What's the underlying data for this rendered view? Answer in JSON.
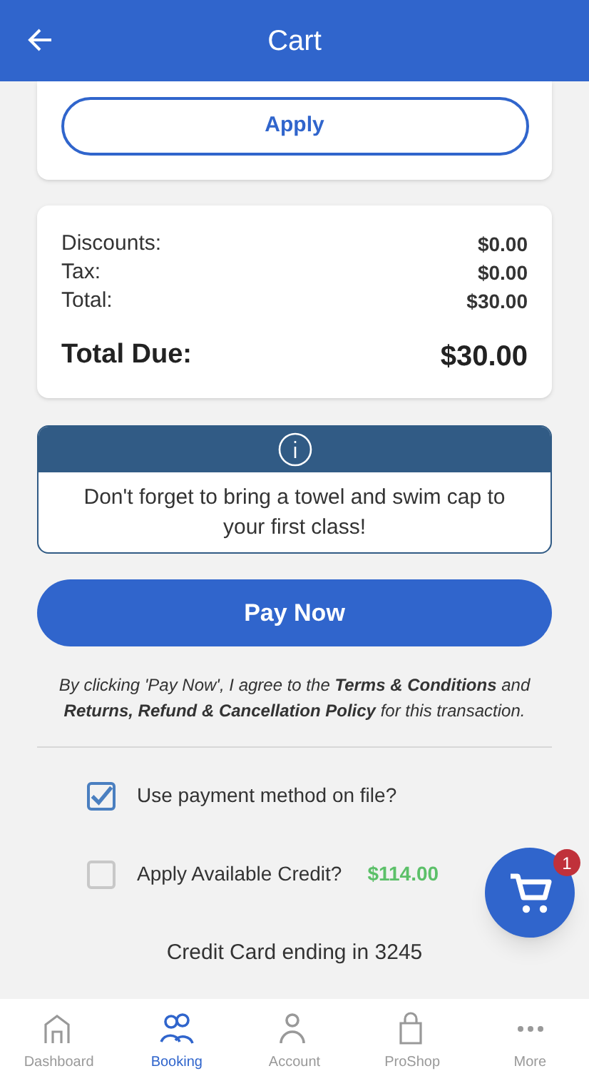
{
  "header": {
    "title": "Cart"
  },
  "apply_button": "Apply",
  "summary": {
    "rows": [
      {
        "label": "Discounts:",
        "value": "$0.00"
      },
      {
        "label": "Tax:",
        "value": "$0.00"
      },
      {
        "label": "Total:",
        "value": "$30.00"
      }
    ],
    "total": {
      "label": "Total Due:",
      "value": "$30.00"
    }
  },
  "notice": {
    "text": "Don't forget to bring a towel and swim cap to your first class!"
  },
  "pay_button": "Pay Now",
  "terms": "By clicking 'Pay Now', I agree to the **Terms & Conditions**  and **Returns, Refund & Cancellation Policy** for this transaction.",
  "options": [
    {
      "label": "Use payment method on file?",
      "checked": true
    },
    {
      "label": "Apply Available Credit?",
      "checked": false,
      "amount": "$114.00"
    }
  ],
  "card_info": "Credit Card ending in 3245",
  "cart_fab": {
    "badge": "1"
  },
  "nav": [
    {
      "label": "Dashboard",
      "kind": "home",
      "selected": false
    },
    {
      "label": "Booking",
      "kind": "people",
      "selected": true
    },
    {
      "label": "Account",
      "kind": "person",
      "selected": false
    },
    {
      "label": "ProShop",
      "kind": "bag",
      "selected": false
    },
    {
      "label": "More",
      "kind": "dots",
      "selected": false
    }
  ]
}
